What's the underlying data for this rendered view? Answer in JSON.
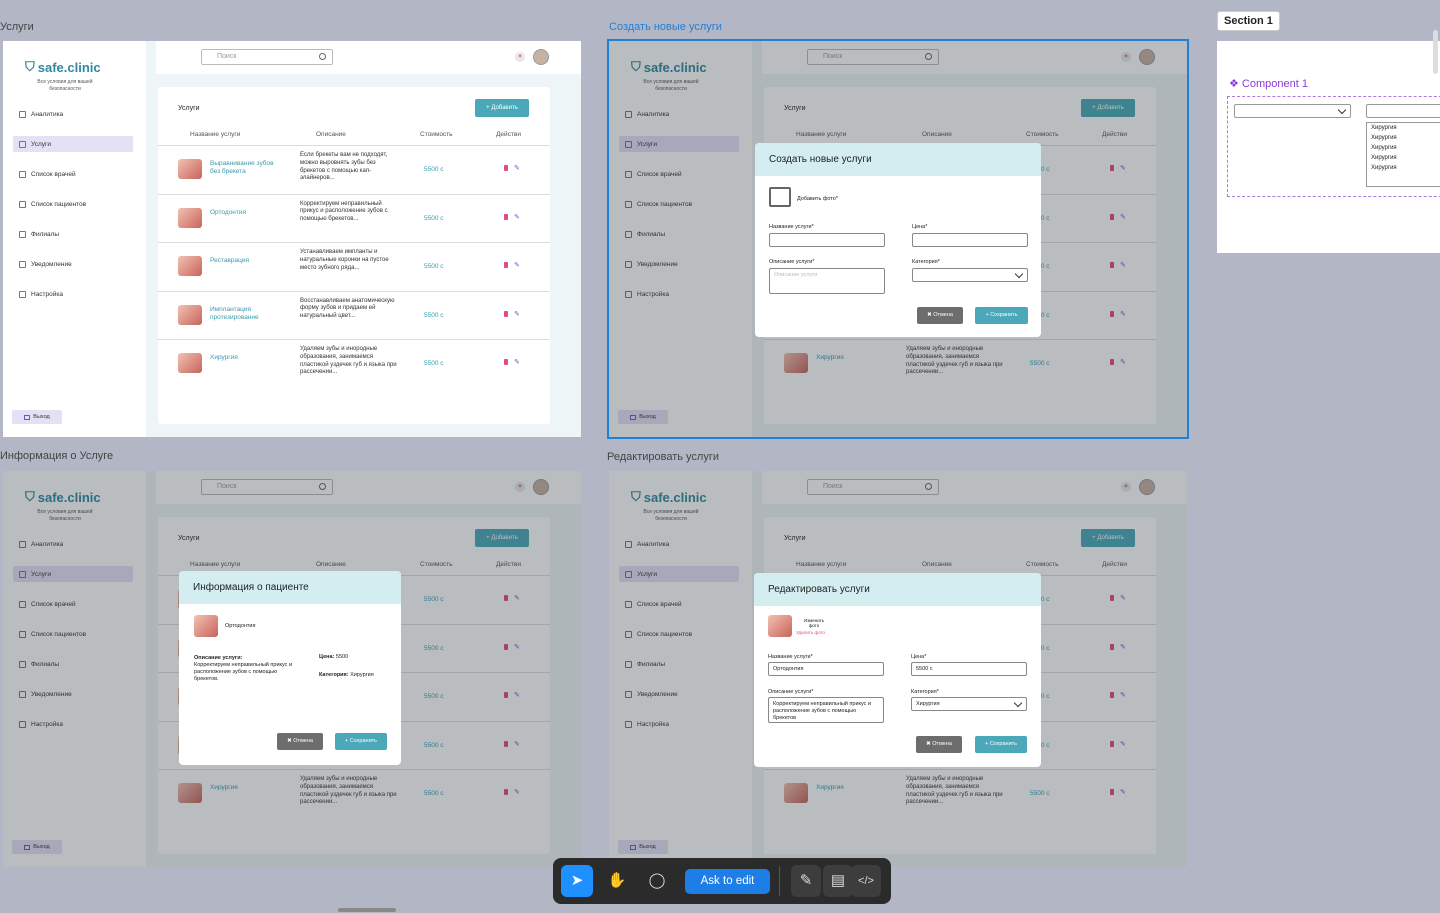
{
  "frame_labels": [
    "Услуги",
    "Создать новые услуги",
    "Информация о Услуге",
    "Редактировать услуги"
  ],
  "app": {
    "logo": "safe.clinic",
    "tagline": "Все условия для вашей безопасности",
    "nav": [
      "Аналитика",
      "Услуги",
      "Список врачей",
      "Список пациентов",
      "Филиалы",
      "Уведомление",
      "Настройка"
    ],
    "logout": "Выход",
    "search_placeholder": "Поиск"
  },
  "services": {
    "title": "Услуги",
    "add_button": "+ Добавить",
    "headers": [
      "Название услуги",
      "Описание",
      "Стоимость",
      "Действи"
    ],
    "rows": [
      {
        "name": "Выравнивание зубов без брекета",
        "desc": "Если брекеты вам не подходят, можно выровнять зубы без брекетов с помощью кап-элайнеров...",
        "price": "5500 с"
      },
      {
        "name": "Ортодонтия",
        "desc": "Корректируем неправильный прикус и расположение зубов с помощью брекетов...",
        "price": "5500 с"
      },
      {
        "name": "Реставрация",
        "desc": "Устанавливаем импланты и натуральные коронки на пустое место зубного ряда...",
        "price": "5500 с"
      },
      {
        "name": "Имплантация протезирование",
        "desc": "Восстанавливаем анатомическую форму зубов и придаем ей натуральный цвет...",
        "price": "5500 с"
      },
      {
        "name": "Хирургия",
        "desc": "Удаляем зубы и инородные образования, занимаемся пластикой уздечек губ и языка при рассечении...",
        "price": "5500 с"
      }
    ],
    "last_row_desc_full": "Удаляем зубы и инородные образования, занимаемся пластикой уздечек губ и языка при рассечении."
  },
  "create_modal": {
    "title": "Создать новые услуги",
    "add_photo": "Добавить фото*",
    "name_label": "Название услуги*",
    "price_label": "Цена*",
    "desc_label": "Описание услуги*",
    "desc_placeholder": "Описание услуги",
    "category_label": "Категория*",
    "cancel": "✖ Отмена",
    "save": "+ Сохранить"
  },
  "info_modal": {
    "title": "Информация о пациенте",
    "service": "Ортодонтия",
    "desc_label": "Описание услуги:",
    "desc": "Корректируем неправильный прикус и расположение зубов с помощью брекетов.",
    "price_label": "Цена:",
    "price": "5500",
    "category_label": "Категория:",
    "category": "Хирургия",
    "cancel": "✖ Отмена",
    "save": "+ Сохранить"
  },
  "edit_modal": {
    "title": "Редактировать услуги",
    "change_photo": "Изменить фото",
    "delete_photo": "Удалить фото",
    "name_label": "Название услуги*",
    "name_value": "Ортодонтия",
    "price_label": "Цена*",
    "price_value": "5500 с",
    "desc_label": "Описание услуги*",
    "desc_value": "Корректируем неправильный прикус и расположение зубов с помощью брекетов",
    "category_label": "Категория*",
    "category_value": "Хирургия",
    "cancel": "✖ Отмена",
    "save": "+ Сохранить"
  },
  "component": {
    "section": "Section 1",
    "name": "❖ Component 1",
    "options": [
      "Хирургия",
      "Хирургия",
      "Хирургия",
      "Хирургия",
      "Хирургия"
    ]
  },
  "toolbar": {
    "ask": "Ask to edit",
    "icons": [
      "cursor-icon",
      "hand-icon",
      "comment-icon",
      "pen-icon",
      "layout-icon",
      "code-icon"
    ]
  }
}
